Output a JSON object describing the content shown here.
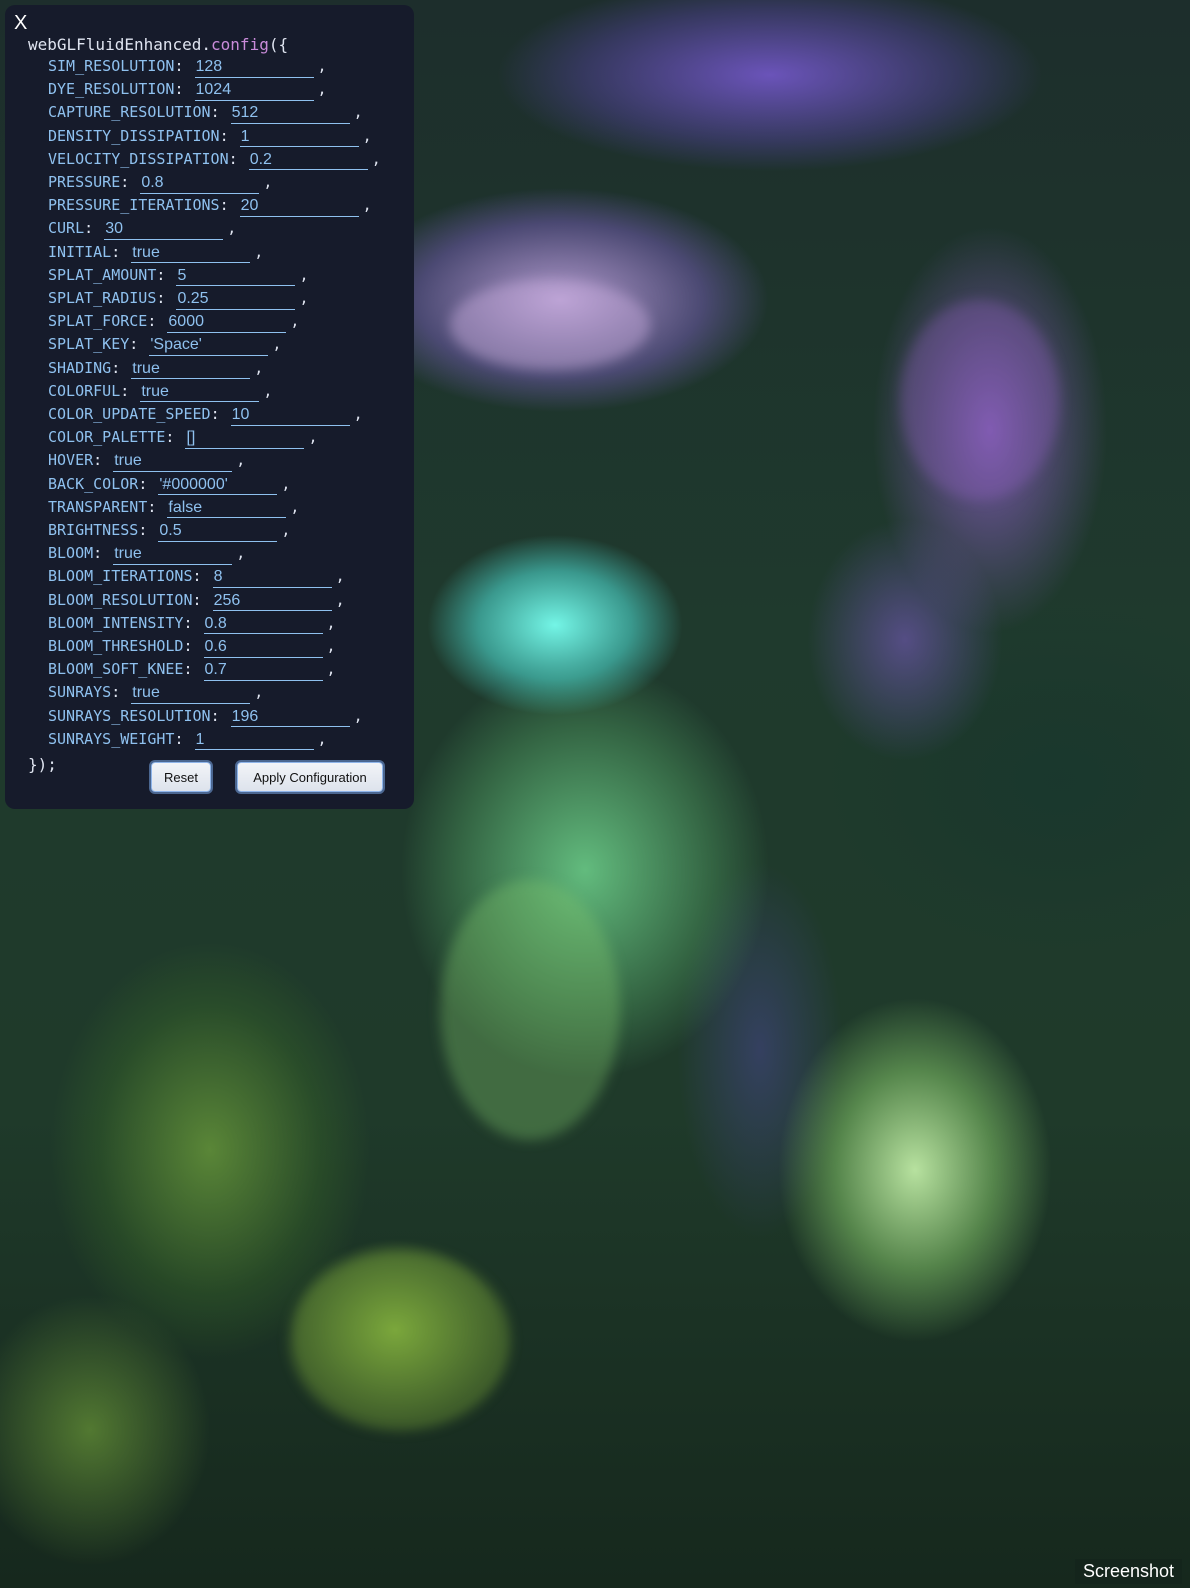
{
  "panel": {
    "close_label": "X",
    "open_line_prefix": "webGLFluidEnhanced.",
    "open_line_method": "config",
    "open_line_suffix": "({",
    "close_line": "});",
    "fields": [
      {
        "key": "SIM_RESOLUTION",
        "value": "128"
      },
      {
        "key": "DYE_RESOLUTION",
        "value": "1024"
      },
      {
        "key": "CAPTURE_RESOLUTION",
        "value": "512"
      },
      {
        "key": "DENSITY_DISSIPATION",
        "value": "1"
      },
      {
        "key": "VELOCITY_DISSIPATION",
        "value": "0.2"
      },
      {
        "key": "PRESSURE",
        "value": "0.8"
      },
      {
        "key": "PRESSURE_ITERATIONS",
        "value": "20"
      },
      {
        "key": "CURL",
        "value": "30"
      },
      {
        "key": "INITIAL",
        "value": "true"
      },
      {
        "key": "SPLAT_AMOUNT",
        "value": "5"
      },
      {
        "key": "SPLAT_RADIUS",
        "value": "0.25"
      },
      {
        "key": "SPLAT_FORCE",
        "value": "6000"
      },
      {
        "key": "SPLAT_KEY",
        "value": "'Space'"
      },
      {
        "key": "SHADING",
        "value": "true"
      },
      {
        "key": "COLORFUL",
        "value": "true"
      },
      {
        "key": "COLOR_UPDATE_SPEED",
        "value": "10"
      },
      {
        "key": "COLOR_PALETTE",
        "value": "[]"
      },
      {
        "key": "HOVER",
        "value": "true"
      },
      {
        "key": "BACK_COLOR",
        "value": "'#000000'"
      },
      {
        "key": "TRANSPARENT",
        "value": "false"
      },
      {
        "key": "BRIGHTNESS",
        "value": "0.5"
      },
      {
        "key": "BLOOM",
        "value": "true"
      },
      {
        "key": "BLOOM_ITERATIONS",
        "value": "8"
      },
      {
        "key": "BLOOM_RESOLUTION",
        "value": "256"
      },
      {
        "key": "BLOOM_INTENSITY",
        "value": "0.8"
      },
      {
        "key": "BLOOM_THRESHOLD",
        "value": "0.6"
      },
      {
        "key": "BLOOM_SOFT_KNEE",
        "value": "0.7"
      },
      {
        "key": "SUNRAYS",
        "value": "true"
      },
      {
        "key": "SUNRAYS_RESOLUTION",
        "value": "196"
      },
      {
        "key": "SUNRAYS_WEIGHT",
        "value": "1"
      }
    ],
    "reset_label": "Reset",
    "apply_label": "Apply Configuration"
  },
  "screenshot_label": "Screenshot",
  "colors": {
    "panel_bg": "#161b2b",
    "key_color": "#8fc1ef",
    "method_color": "#c98bd9"
  }
}
